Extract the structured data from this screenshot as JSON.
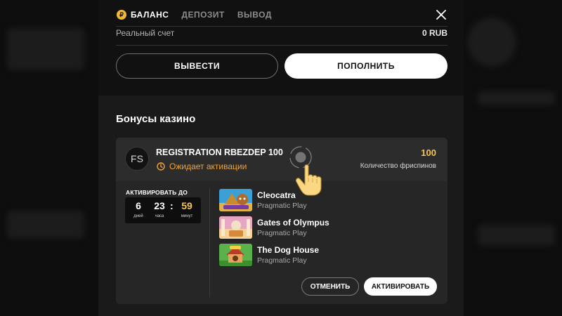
{
  "tabs": [
    {
      "label": "БАЛАНС",
      "icon": "ruble-icon",
      "icon_glyph": "₽",
      "active": true
    },
    {
      "label": "ДЕПОЗИТ",
      "active": false
    },
    {
      "label": "ВЫВОД",
      "active": false
    }
  ],
  "account": {
    "label": "Реальный счет",
    "value": "0 RUB"
  },
  "actions": {
    "withdraw_label": "ВЫВЕСТИ",
    "deposit_label": "ПОПОЛНИТЬ"
  },
  "bonuses": {
    "section_title": "Бонусы казино",
    "card": {
      "badge": "FS",
      "name": "REGISTRATION RBEZDEP 100",
      "status": "Ожидает активации",
      "freespins_count": "100",
      "freespins_label": "Количество фриспинов",
      "activate_until_label": "АКТИВИРОВАТЬ ДО",
      "timer": {
        "days": "6",
        "days_label": "дней",
        "hours": "23",
        "hours_label": "часа",
        "separator": ":",
        "minutes": "59",
        "minutes_label": "минут"
      },
      "games": [
        {
          "title": "Cleocatra",
          "provider": "Pragmatic Play"
        },
        {
          "title": "Gates of Olympus",
          "provider": "Pragmatic Play"
        },
        {
          "title": "The Dog House",
          "provider": "Pragmatic Play"
        }
      ],
      "cancel_label": "ОТМЕНИТЬ",
      "activate_label": "АКТИВИРОВАТЬ"
    }
  },
  "colors": {
    "accent_yellow": "#f6c54a",
    "status_orange": "#f0a23a",
    "modal_bg": "#1a1a1a",
    "card_bg": "#262626"
  }
}
